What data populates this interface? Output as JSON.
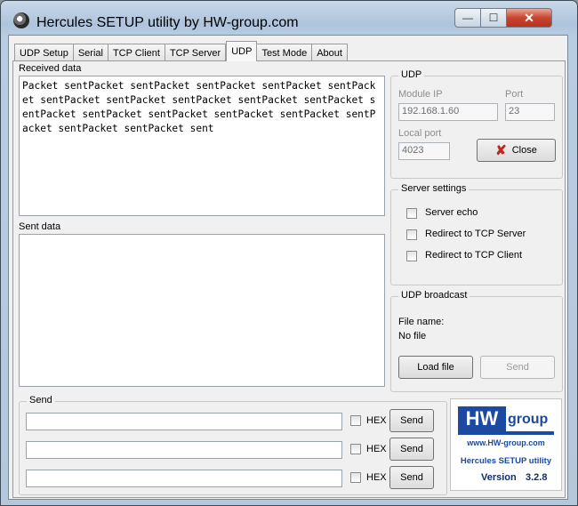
{
  "window": {
    "title": "Hercules SETUP utility by HW-group.com",
    "minimize_glyph": "—",
    "maximize_glyph": "☐",
    "close_glyph": "✕"
  },
  "tabs": [
    {
      "label": "UDP Setup",
      "active": false
    },
    {
      "label": "Serial",
      "active": false
    },
    {
      "label": "TCP Client",
      "active": false
    },
    {
      "label": "TCP Server",
      "active": false
    },
    {
      "label": "UDP",
      "active": true
    },
    {
      "label": "Test Mode",
      "active": false
    },
    {
      "label": "About",
      "active": false
    }
  ],
  "received": {
    "label": "Received data",
    "text": "Packet sentPacket sentPacket sentPacket sentPacket sentPacket sentPacket sentPacket sentPacket sentPacket sentPacket sentPacket sentPacket sentPacket sentPacket sentPacket sentPacket sentPacket sentPacket sent"
  },
  "sent": {
    "label": "Sent data",
    "text": ""
  },
  "udp": {
    "title": "UDP",
    "module_ip_label": "Module IP",
    "module_ip": "192.168.1.60",
    "port_label": "Port",
    "port": "23",
    "local_port_label": "Local port",
    "local_port": "4023",
    "close_button": "Close",
    "close_icon": "x-red-icon"
  },
  "server_settings": {
    "title": "Server settings",
    "options": [
      {
        "label": "Server echo",
        "checked": false
      },
      {
        "label": "Redirect to TCP Server",
        "checked": false
      },
      {
        "label": "Redirect to TCP Client",
        "checked": false
      }
    ]
  },
  "broadcast": {
    "title": "UDP broadcast",
    "file_name_label": "File name:",
    "file_name": "No file",
    "load_button": "Load file",
    "send_button": "Send"
  },
  "send_group": {
    "title": "Send",
    "rows": [
      {
        "value": "",
        "hex_label": "HEX",
        "hex_checked": false,
        "send_label": "Send"
      },
      {
        "value": "",
        "hex_label": "HEX",
        "hex_checked": false,
        "send_label": "Send"
      },
      {
        "value": "",
        "hex_label": "HEX",
        "hex_checked": false,
        "send_label": "Send"
      }
    ]
  },
  "logo": {
    "hw": "HW",
    "group": "group",
    "url": "www.HW-group.com",
    "product": "Hercules SETUP utility",
    "version_label": "Version",
    "version": "3.2.8",
    "brand_color": "#1b4aa0"
  }
}
